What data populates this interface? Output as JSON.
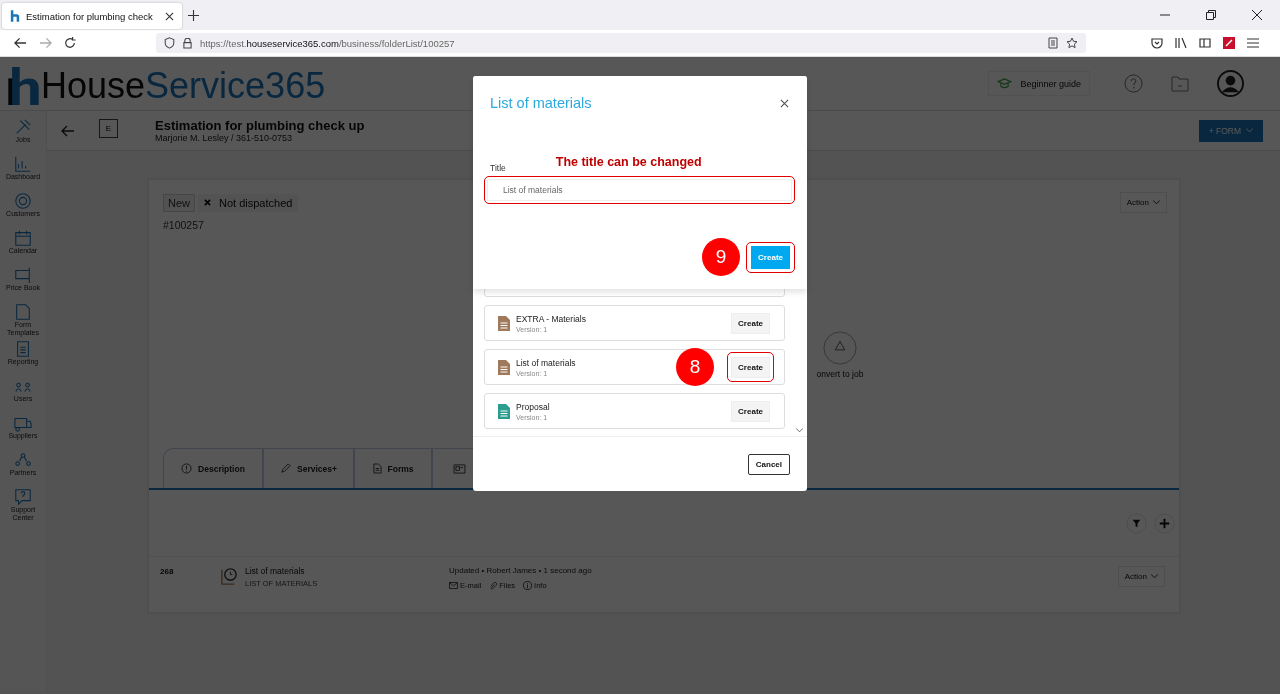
{
  "browser": {
    "tab_title": "Estimation for plumbing check",
    "url_prefix": "https://test.",
    "url_domain": "houseservice365.com",
    "url_path": "/business/folderList/100257"
  },
  "header": {
    "logo_first": "House",
    "logo_second": "Service365",
    "beginner_guide": "Beginner guide"
  },
  "sidebar": [
    {
      "label": "Jobs"
    },
    {
      "label": "Dashboard"
    },
    {
      "label": "Customers"
    },
    {
      "label": "Calendar"
    },
    {
      "label": "Price Book"
    },
    {
      "label": "Form Templates"
    },
    {
      "label": "Reporting"
    },
    {
      "label": "Users"
    },
    {
      "label": "Suppliers"
    },
    {
      "label": "Partners"
    },
    {
      "label": "Support Center"
    }
  ],
  "job": {
    "badge": "E",
    "title": "Estimation for plumbing check up",
    "subtitle": "Marjorie M. Lesley / 361-510-0753",
    "form_button": "+ FORM",
    "status": "New",
    "dispatch": "Not dispatched",
    "number": "#100257",
    "action": "Action",
    "convert": "onvert to job"
  },
  "tabs": [
    {
      "kind": "labeled",
      "label": "Description"
    },
    {
      "kind": "labeled",
      "label": "Services+"
    },
    {
      "kind": "labeled",
      "label": "Forms"
    },
    {
      "kind": "icon_only"
    }
  ],
  "forms": [
    {
      "number": "268",
      "title": "List of materials",
      "subtitle": "LIST OF MATERIALS",
      "updated": "Updated • Robert James • 1 second ago",
      "links": [
        "E-mail",
        "Files",
        "Info"
      ],
      "action": "Action"
    }
  ],
  "modal": {
    "templates": [
      {
        "name": "EXTRA - Materials",
        "version": "Version: 1",
        "button": "Create",
        "color": "#a0785a"
      },
      {
        "name": "List of materials",
        "version": "Version: 1",
        "button": "Create",
        "color": "#a0785a"
      },
      {
        "name": "Proposal",
        "version": "Version: 1",
        "button": "Create",
        "color": "#2a9d8f"
      }
    ],
    "cancel": "Cancel"
  },
  "dialog": {
    "title": "List of materials",
    "field_label": "Title",
    "value": "List of materials",
    "create": "Create"
  },
  "annotations": {
    "note": "The title can be changed",
    "step_dialog": "9",
    "step_list": "8"
  }
}
